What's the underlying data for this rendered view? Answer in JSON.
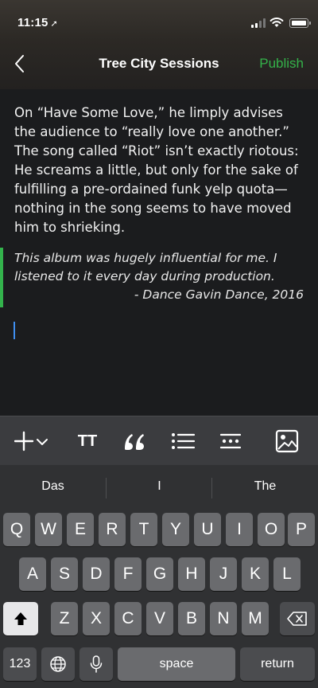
{
  "status": {
    "time": "11:15"
  },
  "nav": {
    "title": "Tree City Sessions",
    "publish": "Publish"
  },
  "editor": {
    "paragraph": "On “Have Some Love,” he limply advises the audience to “really love one another.” The song called “Riot” isn’t exactly riotous: He screams a little, but only for the sake of fulfilling a pre-ordained funk yelp quota—nothing in the song seems to have moved him to shrieking.",
    "quote": "This album was hugely influential for me. I listened to it every day during production.",
    "attribution": "- Dance Gavin Dance, 2016"
  },
  "toolbar": {
    "icons": [
      "plus-dropdown-icon",
      "text-size-icon",
      "quote-icon",
      "list-icon",
      "separator-icon",
      "image-icon"
    ],
    "text_size_label": "TT"
  },
  "keyboard": {
    "suggestions": [
      "Das",
      "I",
      "The"
    ],
    "row1": [
      "Q",
      "W",
      "E",
      "R",
      "T",
      "Y",
      "U",
      "I",
      "O",
      "P"
    ],
    "row2": [
      "A",
      "S",
      "D",
      "F",
      "G",
      "H",
      "J",
      "K",
      "L"
    ],
    "row3": [
      "Z",
      "X",
      "C",
      "V",
      "B",
      "N",
      "M"
    ],
    "numbers": "123",
    "space": "space",
    "return": "return"
  },
  "colors": {
    "accent": "#34b24a",
    "caret": "#3f8ef0",
    "background": "#1b1c1e"
  }
}
